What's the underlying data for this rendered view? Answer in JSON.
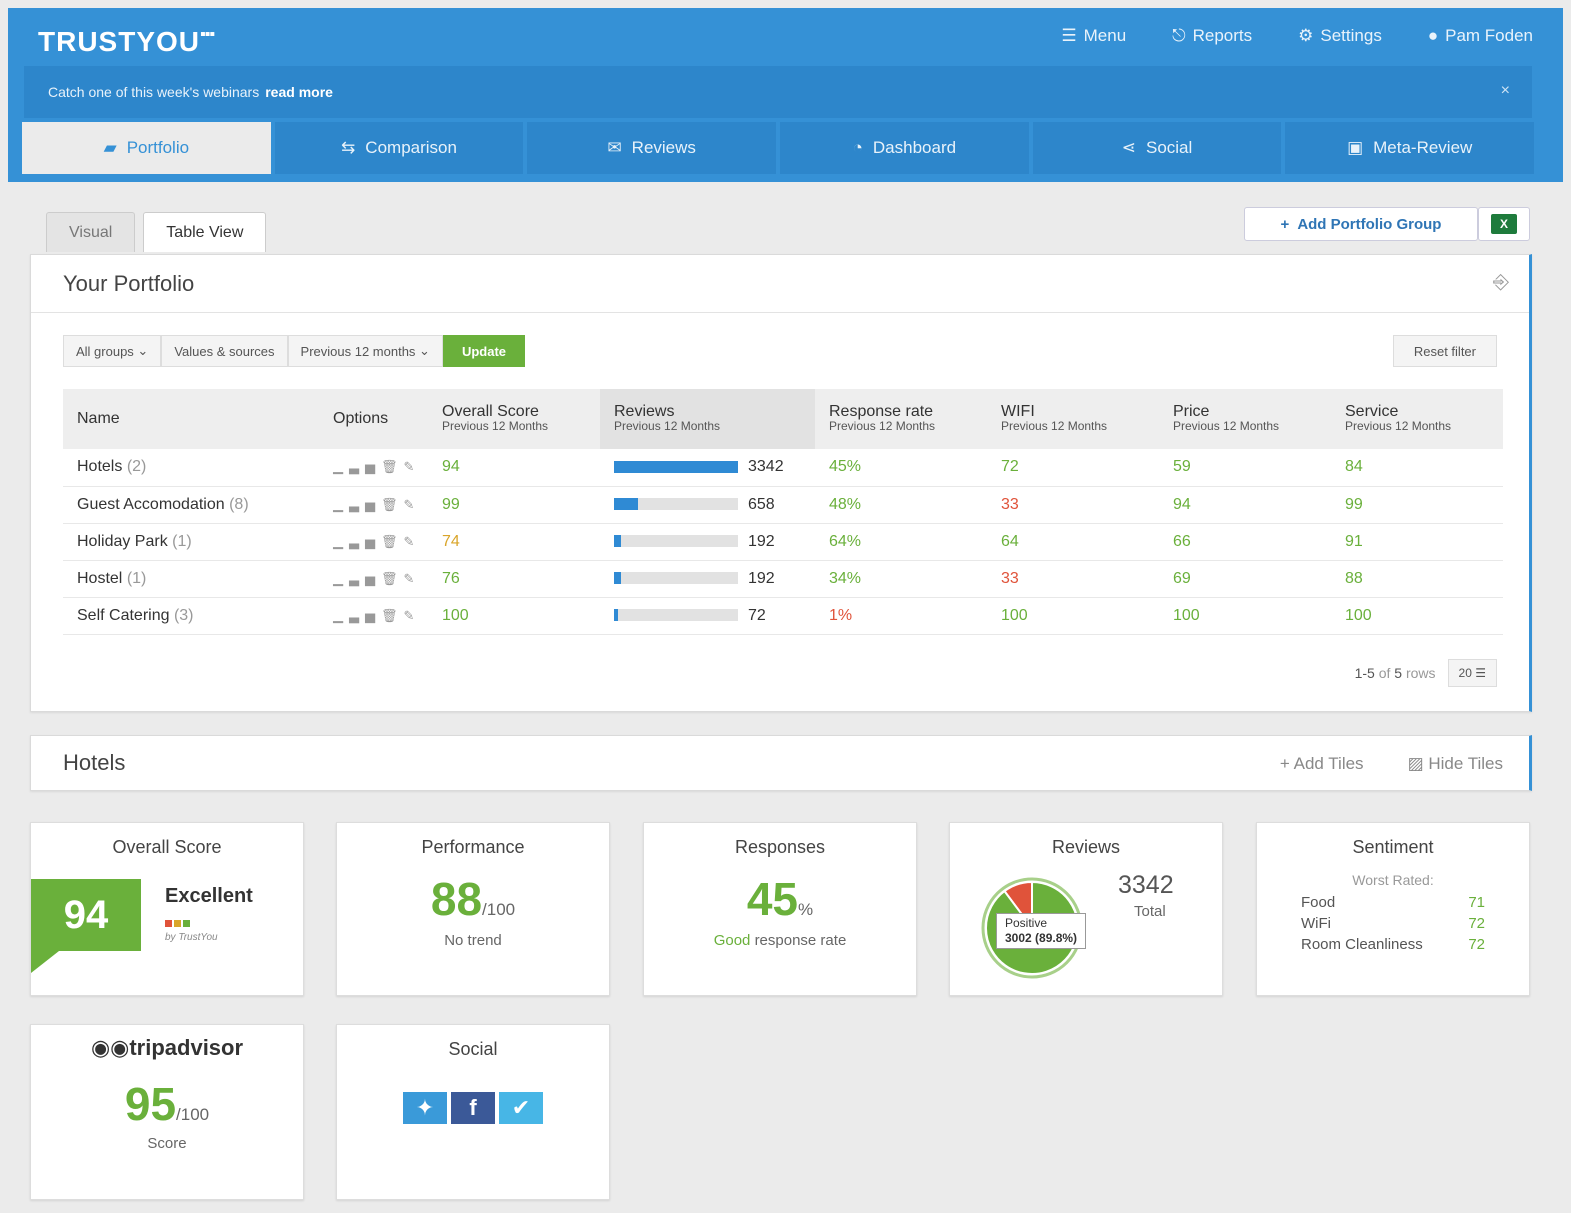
{
  "brand": {
    "logo": "TRUSTYOU",
    "logo_dots": "▪▪▪"
  },
  "topnav": [
    {
      "icon": "menu-icon",
      "label": "Menu"
    },
    {
      "icon": "reports-icon",
      "label": "Reports"
    },
    {
      "icon": "gear-icon",
      "label": "Settings"
    },
    {
      "icon": "user-icon",
      "label": "Pam Foden"
    }
  ],
  "banner": {
    "text": "Catch one of this week's webinars",
    "link": "read more",
    "close": "×"
  },
  "main_tabs": [
    {
      "icon": "folder-icon",
      "label": "Portfolio",
      "active": true
    },
    {
      "icon": "compare-icon",
      "label": "Comparison"
    },
    {
      "icon": "chat-icon",
      "label": "Reviews"
    },
    {
      "icon": "gauge-icon",
      "label": "Dashboard"
    },
    {
      "icon": "share-icon",
      "label": "Social"
    },
    {
      "icon": "metareview-icon",
      "label": "Meta-Review"
    }
  ],
  "sub_tabs": [
    {
      "label": "Visual"
    },
    {
      "label": "Table View",
      "active": true
    }
  ],
  "actions": {
    "add_group": "Add Portfolio Group",
    "excel_icon": "excel-icon"
  },
  "portfolio": {
    "title": "Your Portfolio",
    "filters": {
      "groups": "All groups",
      "values": "Values & sources",
      "period": "Previous 12 months",
      "update": "Update",
      "reset": "Reset filter"
    },
    "columns": [
      {
        "label": "Name",
        "sub": ""
      },
      {
        "label": "Options",
        "sub": ""
      },
      {
        "label": "Overall Score",
        "sub": "Previous 12 Months"
      },
      {
        "label": "Reviews",
        "sub": "Previous 12 Months"
      },
      {
        "label": "Response rate",
        "sub": "Previous 12 Months"
      },
      {
        "label": "WIFI",
        "sub": "Previous 12 Months"
      },
      {
        "label": "Price",
        "sub": "Previous 12 Months"
      },
      {
        "label": "Service",
        "sub": "Previous 12 Months"
      }
    ],
    "rows": [
      {
        "name": "Hotels",
        "count": "(2)",
        "score": "94",
        "reviews": 3342,
        "reviews_pct": 1.0,
        "response": "45%",
        "wifi": "72",
        "price": "59",
        "service": "84",
        "score_c": "g",
        "response_c": "g",
        "wifi_c": "g",
        "price_c": "g",
        "service_c": "g"
      },
      {
        "name": "Guest Accomodation",
        "count": "(8)",
        "score": "99",
        "reviews": 658,
        "reviews_pct": 0.197,
        "response": "48%",
        "wifi": "33",
        "price": "94",
        "service": "99",
        "score_c": "g",
        "response_c": "g",
        "wifi_c": "r",
        "price_c": "g",
        "service_c": "g"
      },
      {
        "name": "Holiday Park",
        "count": "(1)",
        "score": "74",
        "reviews": 192,
        "reviews_pct": 0.057,
        "response": "64%",
        "wifi": "64",
        "price": "66",
        "service": "91",
        "score_c": "o",
        "response_c": "g",
        "wifi_c": "g",
        "price_c": "g",
        "service_c": "g"
      },
      {
        "name": "Hostel",
        "count": "(1)",
        "score": "76",
        "reviews": 192,
        "reviews_pct": 0.057,
        "response": "34%",
        "wifi": "33",
        "price": "69",
        "service": "88",
        "score_c": "g",
        "response_c": "g",
        "wifi_c": "r",
        "price_c": "g",
        "service_c": "g"
      },
      {
        "name": "Self Catering",
        "count": "(3)",
        "score": "100",
        "reviews": 72,
        "reviews_pct": 0.022,
        "response": "1%",
        "wifi": "100",
        "price": "100",
        "service": "100",
        "score_c": "g",
        "response_c": "r",
        "wifi_c": "g",
        "price_c": "g",
        "service_c": "g"
      }
    ],
    "pager": {
      "range": "1-5",
      "of": "of",
      "total": "5",
      "unit": "rows",
      "size": "20"
    }
  },
  "hotels": {
    "title": "Hotels",
    "add_tiles": "Add Tiles",
    "hide_tiles": "Hide Tiles",
    "tiles": {
      "overall": {
        "title": "Overall Score",
        "score": "94",
        "label": "Excellent",
        "by": "by TrustYou"
      },
      "performance": {
        "title": "Performance",
        "value": "88",
        "unit": "/100",
        "trend": "No trend"
      },
      "responses": {
        "title": "Responses",
        "value": "45",
        "unit": "%",
        "good": "Good",
        "rest": "response rate"
      },
      "reviews": {
        "title": "Reviews",
        "total": "3342",
        "total_label": "Total",
        "pos_label": "Positive",
        "pos_value": "3002 (89.8%)",
        "positive_share": 0.898
      },
      "sentiment": {
        "title": "Sentiment",
        "worst": "Worst Rated:",
        "items": [
          {
            "k": "Food",
            "v": "71"
          },
          {
            "k": "WiFi",
            "v": "72"
          },
          {
            "k": "Room Cleanliness",
            "v": "72"
          }
        ]
      },
      "tripadvisor": {
        "brand": "tripadvisor",
        "value": "95",
        "unit": "/100",
        "label": "Score"
      },
      "social": {
        "title": "Social"
      }
    }
  },
  "colors": {
    "primary": "#3591d6",
    "green": "#6ab03b",
    "orange": "#d9a52a",
    "red": "#e0533a"
  }
}
